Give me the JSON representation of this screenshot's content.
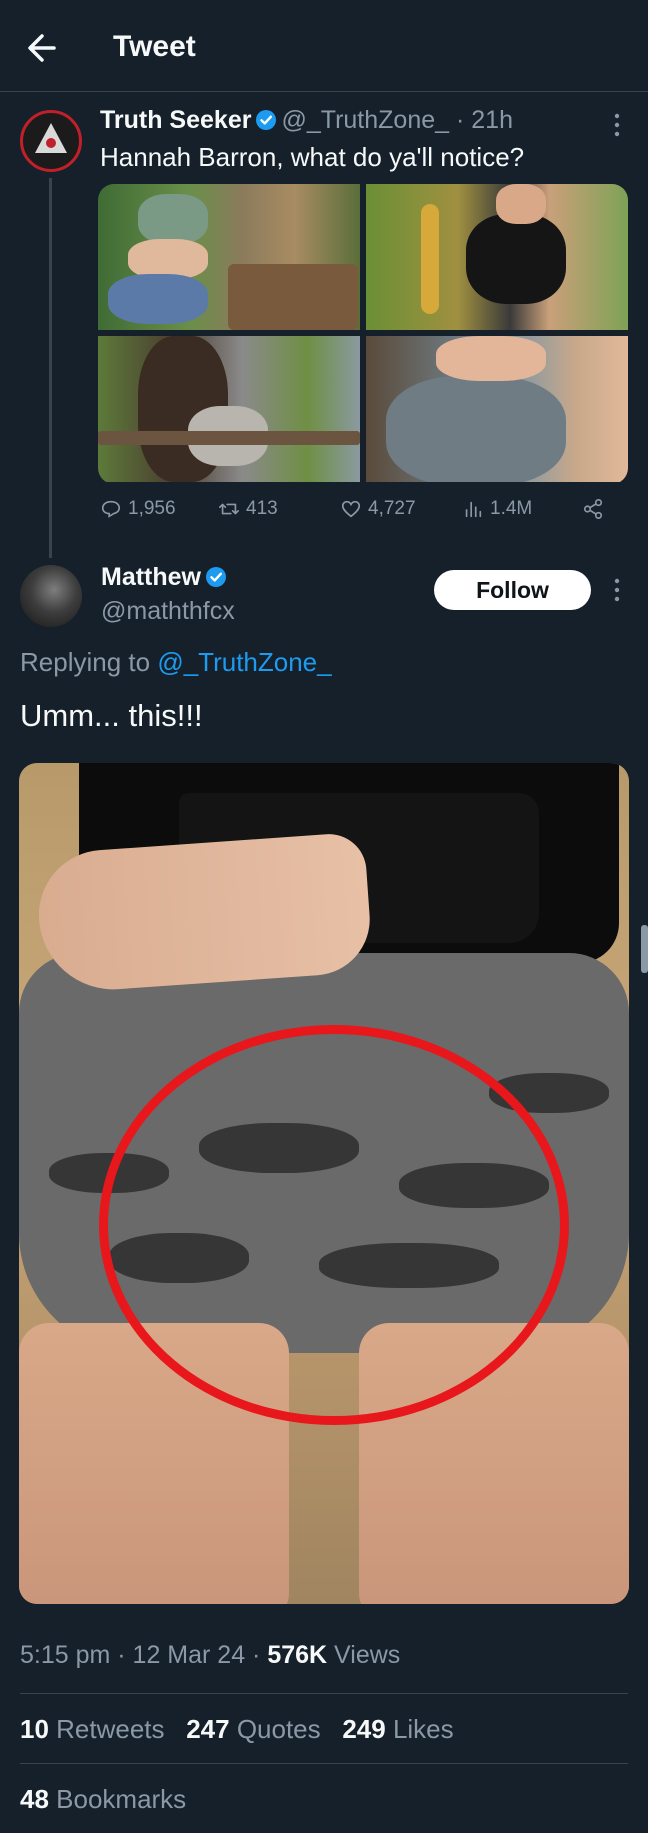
{
  "header": {
    "title": "Tweet",
    "back_icon": "arrow-left-icon"
  },
  "quoted_tweet": {
    "name": "Truth Seeker",
    "handle": "@_TruthZone_",
    "time": "· 21h",
    "text": "Hannah Barron, what do ya'll notice?",
    "stats": {
      "replies": "1,956",
      "retweets": "413",
      "likes": "4,727",
      "views": "1.4M"
    }
  },
  "main_tweet": {
    "name": "Matthew",
    "handle": "@maththfcx",
    "follow_label": "Follow",
    "replying_prefix": "Replying to",
    "replying_handle": "@_TruthZone_",
    "text": "Umm... this!!!",
    "meta": {
      "time": "5:15 pm · 12 Mar 24 · ",
      "views_count": "576K",
      "views_label": " Views"
    },
    "stats": {
      "retweets_count": "10",
      "retweets_label": " Retweets",
      "quotes_count": "247",
      "quotes_label": " Quotes",
      "likes_count": "249",
      "likes_label": " Likes",
      "bookmarks_count": "48",
      "bookmarks_label": " Bookmarks"
    }
  },
  "colors": {
    "background": "#15202b",
    "accent": "#1d9bf0",
    "muted": "#8b98a5",
    "highlight_ring": "#e8171c"
  }
}
